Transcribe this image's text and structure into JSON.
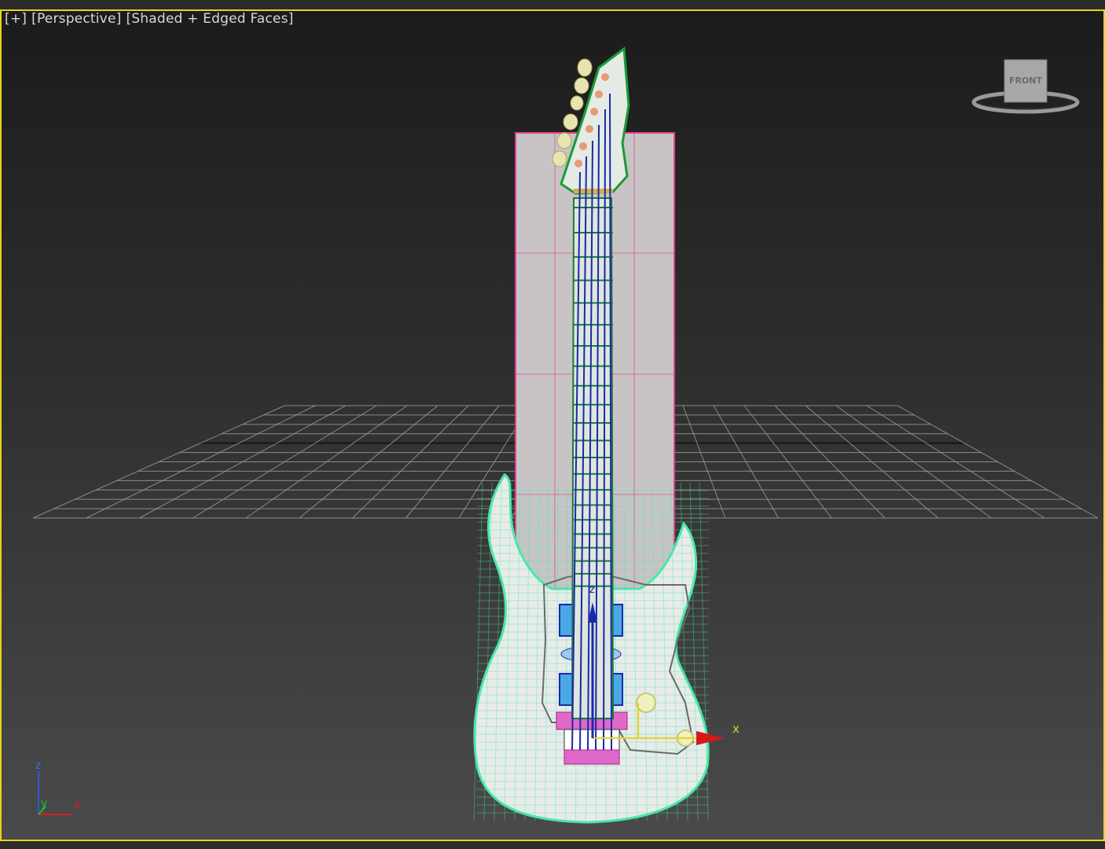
{
  "viewport": {
    "menu_label": "[+]",
    "view_label": "[Perspective]",
    "shading_label": "[Shaded + Edged Faces]",
    "active_border_color": "#e8d21a"
  },
  "viewcube": {
    "face_label": "FRONT"
  },
  "gizmo": {
    "x_label": "x",
    "z_label": "z"
  },
  "axis_tripod": {
    "z": "z",
    "y": "y",
    "x": "x"
  },
  "colors": {
    "wire_body": "#49e8a6",
    "wire_neck": "#1a7a3a",
    "strings": "#1a2aa8",
    "ref_plane": "#c8c4c6",
    "ref_plane_edge": "#e0408a",
    "gizmo_x": "#d81818"
  }
}
